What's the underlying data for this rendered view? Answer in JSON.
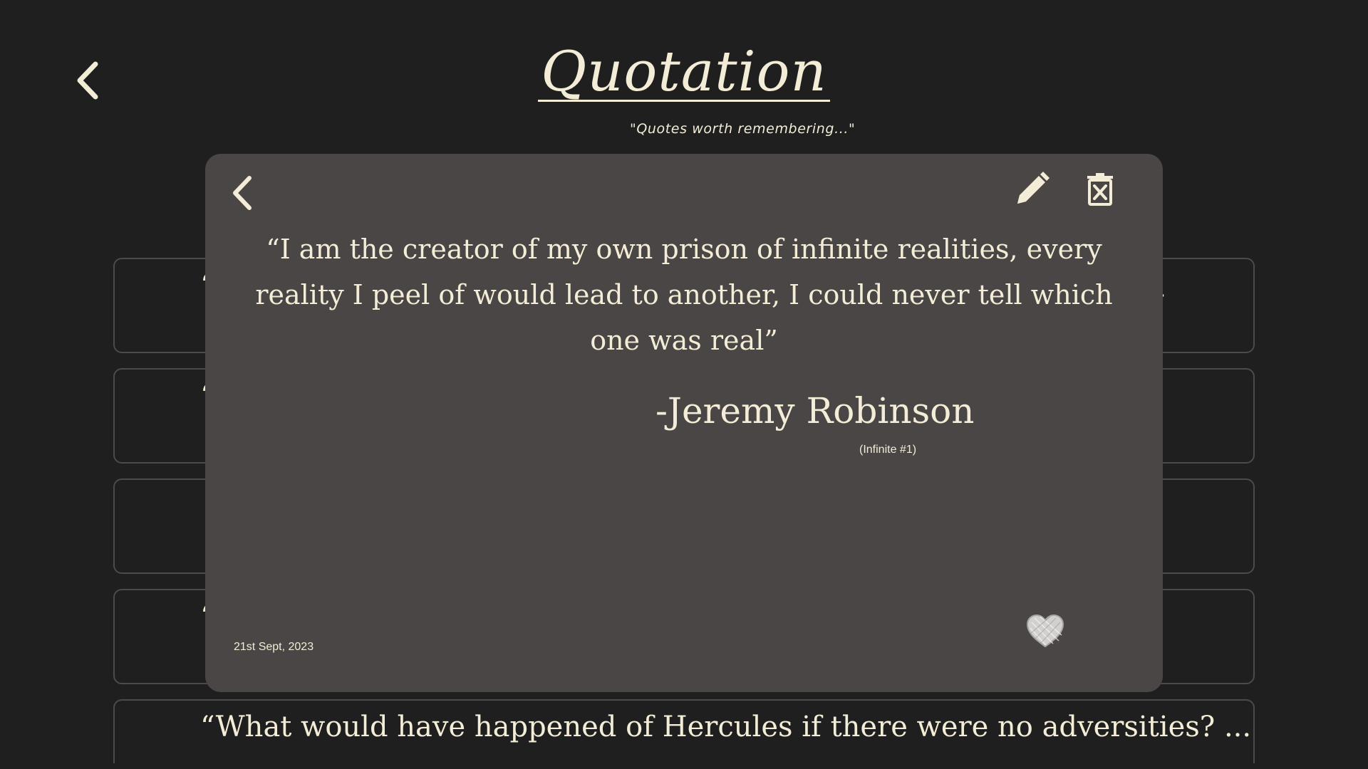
{
  "header": {
    "title": "Quotation",
    "subtitle": "\"Quotes worth remembering...\""
  },
  "list": {
    "items": [
      {
        "text": "“",
        "tail": "-"
      },
      {
        "text": "“",
        "tail": ""
      },
      {
        "text": "",
        "tail": ""
      },
      {
        "text": "“",
        "tail": ""
      },
      {
        "text": "“What would have happened of Hercules if there were no adversities? ..."
      }
    ]
  },
  "modal": {
    "quote": "“I am the creator of my own prison of infinite realities, every reality I peel of would lead to another, I could never tell which one was real”",
    "author": "-Jeremy Robinson",
    "source": "(Infinite #1)",
    "date": "21st Sept, 2023"
  },
  "icons": {
    "back": "chevron-left-icon",
    "edit": "pencil-icon",
    "delete": "trash-x-icon",
    "favorite": "heart-icon"
  },
  "colors": {
    "background": "#1f1f1f",
    "modal": "#4b4646",
    "text": "#f3ecd6",
    "card_border": "#4d4a4a"
  }
}
